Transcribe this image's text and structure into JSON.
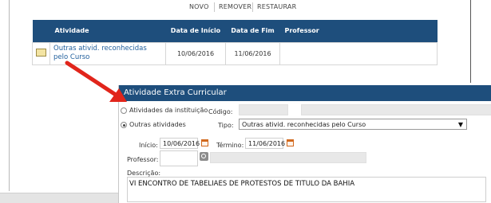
{
  "toolbar": {
    "novo": "NOVO",
    "remover": "REMOVER",
    "restaurar": "RESTAURAR"
  },
  "grid": {
    "headers": [
      "Atividade",
      "Data de Início",
      "Data de Fim",
      "Professor"
    ],
    "rows": [
      {
        "atividade": "Outras ativid. reconhecidas pelo Curso",
        "inicio": "10/06/2016",
        "fim": "11/06/2016",
        "professor": ""
      }
    ]
  },
  "dialog": {
    "title": "Atividade Extra Curricular",
    "radio_instituicao": "Atividades da instituição",
    "radio_outras": "Outras atividades",
    "selected_radio": "outras",
    "codigo_label": "Código:",
    "codigo_value": "",
    "tipo_label": "Tipo:",
    "tipo_value": "Outras ativid. reconhecidas pelo Curso",
    "inicio_label": "Início:",
    "inicio_value": "10/06/2016",
    "termino_label": "Término:",
    "termino_value": "11/06/2016",
    "professor_label": "Professor:",
    "professor_value": "",
    "descricao_label": "Descrição:",
    "descricao_value": "VI ENCONTRO DE TABELIAES DE PROTESTOS DE TITULO DA BAHIA"
  },
  "colors": {
    "header_blue": "#1e4e7c",
    "link_blue": "#1f5e9c",
    "arrow_red": "#e1251b",
    "calendar_orange": "#d2691e"
  },
  "icons": [
    "row-edit-icon",
    "calendar-icon",
    "search-icon",
    "dropdown-caret-icon",
    "arrow-icon"
  ]
}
